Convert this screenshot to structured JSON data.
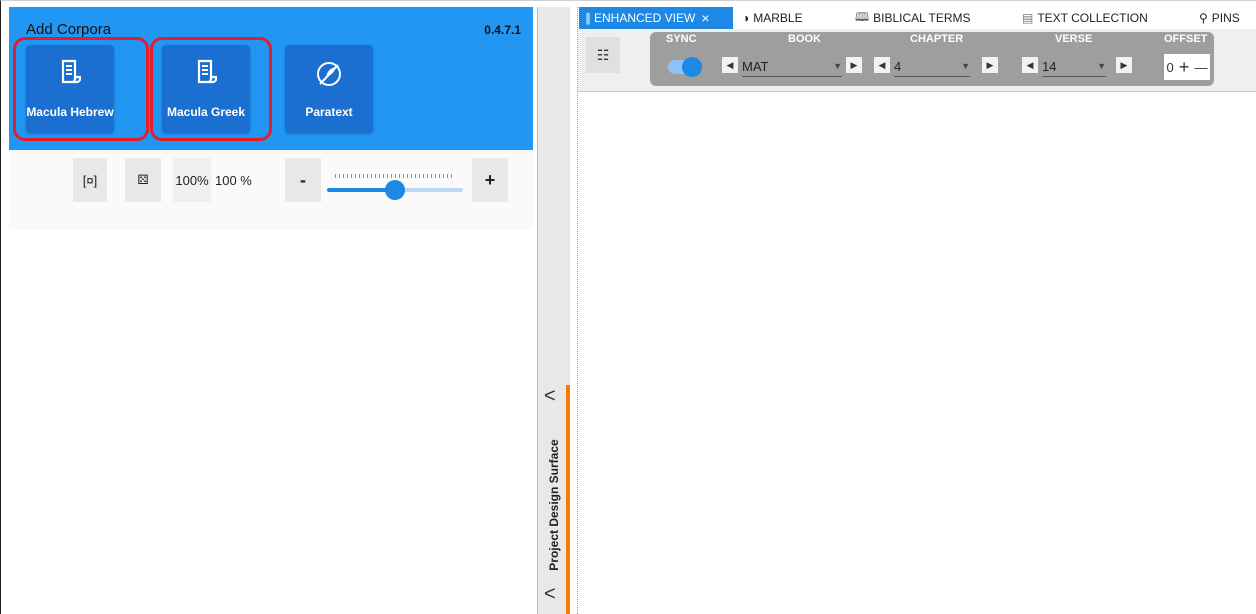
{
  "app": {
    "corpora_title": "Add Corpora",
    "version": "0.4.7.1",
    "corpora": [
      {
        "label": "Macula Hebrew",
        "icon": "scroll-icon",
        "highlighted": true
      },
      {
        "label": "Macula Greek",
        "icon": "scroll-icon",
        "highlighted": true
      },
      {
        "label": "Paratext",
        "icon": "quill-icon",
        "highlighted": false
      }
    ],
    "highlight_color": "#e31e2a",
    "accent_color": "#2196f3"
  },
  "zoom": {
    "fit_icon": "fit-screen-icon",
    "random_icon": "dice-icon",
    "preset_label": "100%",
    "value_label": "100 %",
    "minus_label": "-",
    "plus_label": "+",
    "slider_level": 0.5
  },
  "splitter": {
    "label": "Project Design Surface",
    "accent_color": "#f57c00"
  },
  "tabs": [
    {
      "label": "ENHANCED VIEW",
      "icon": "enhanced-view-icon",
      "active": true,
      "close": "×"
    },
    {
      "label": "MARBLE",
      "icon": "marble-icon",
      "active": false
    },
    {
      "label": "BIBLICAL TERMS",
      "icon": "book-icon",
      "active": false
    },
    {
      "label": "TEXT COLLECTION",
      "icon": "document-icon",
      "active": false
    },
    {
      "label": "PINS",
      "icon": "pin-icon",
      "active": false
    }
  ],
  "nav": {
    "headers": {
      "sync": "SYNC",
      "book": "BOOK",
      "chapter": "CHAPTER",
      "verse": "VERSE",
      "offset": "OFFSET"
    },
    "sync_on": true,
    "book": "MAT",
    "chapter": "4",
    "verse": "14",
    "offset": "0",
    "offset_plus": "+",
    "offset_minus": "—"
  }
}
